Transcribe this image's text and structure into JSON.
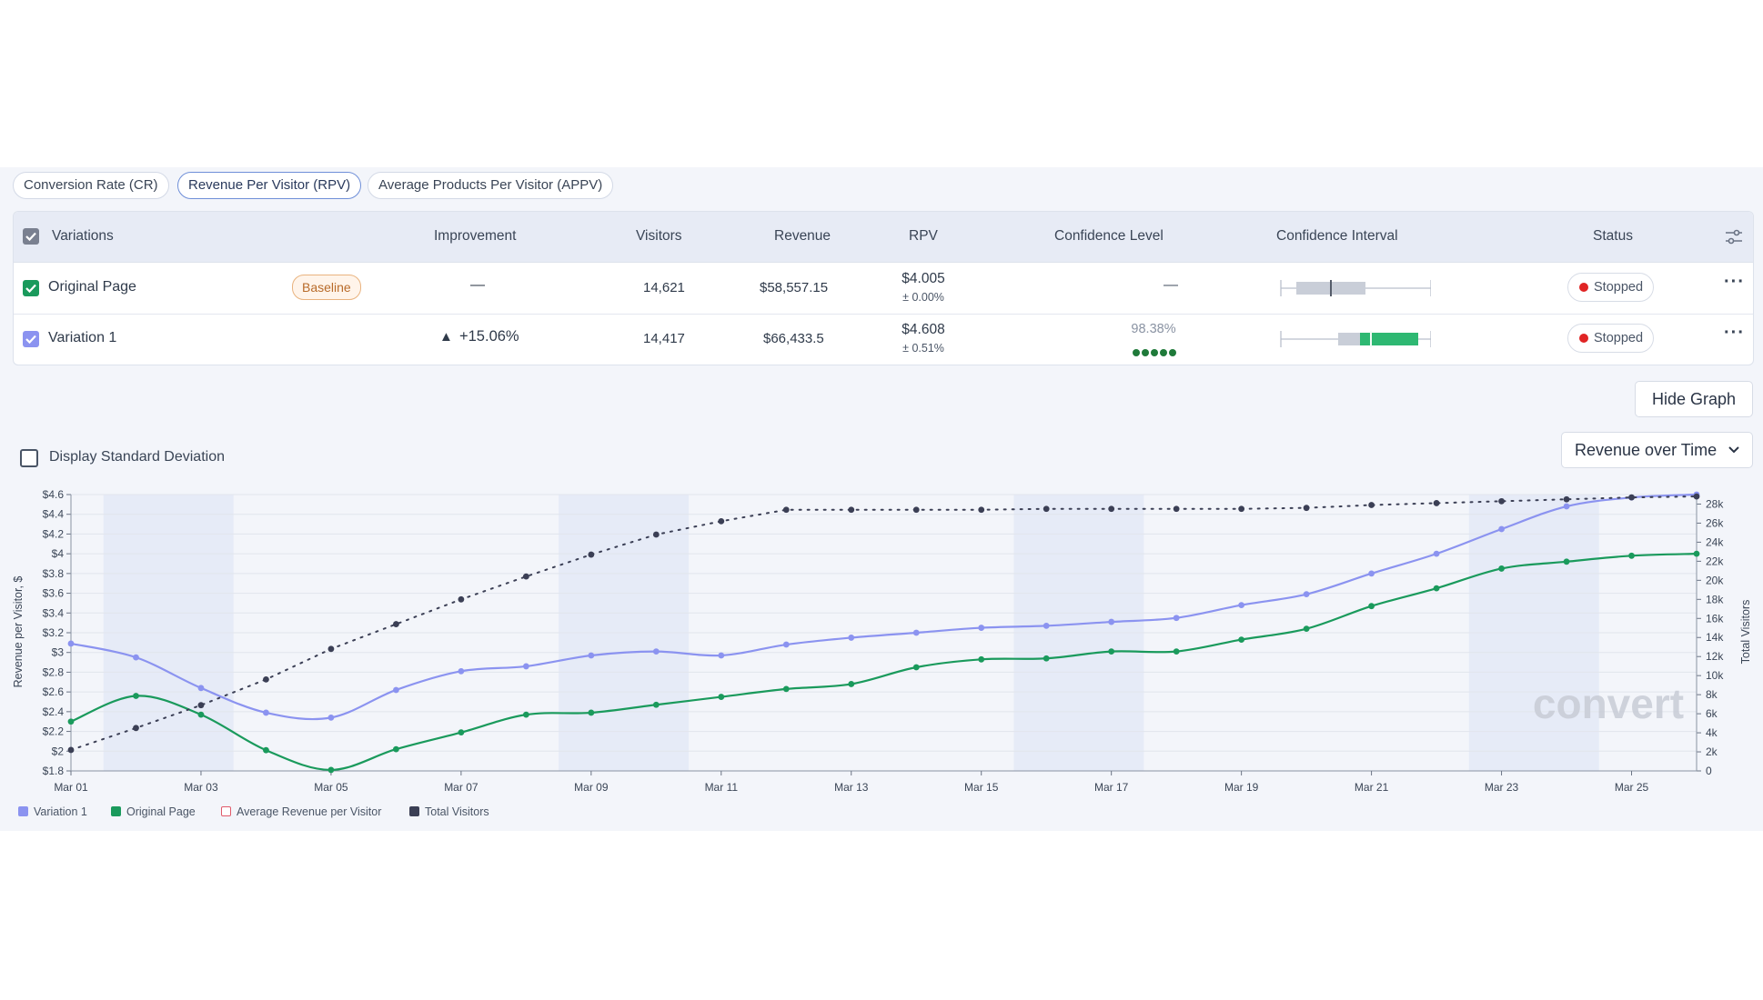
{
  "tabs": [
    {
      "label": "Conversion Rate (CR)",
      "active": false
    },
    {
      "label": "Revenue Per Visitor (RPV)",
      "active": true
    },
    {
      "label": "Average Products Per Visitor (APPV)",
      "active": false
    }
  ],
  "table": {
    "headers": {
      "variations": "Variations",
      "improvement": "Improvement",
      "visitors": "Visitors",
      "revenue": "Revenue",
      "rpv": "RPV",
      "confidence_level": "Confidence Level",
      "confidence_interval": "Confidence Interval",
      "status": "Status"
    },
    "rows": [
      {
        "name": "Original Page",
        "checkbox_color": "#1a9a5c",
        "badge": "Baseline",
        "improvement": "—",
        "visitors": "14,621",
        "revenue": "$58,557.15",
        "rpv": "$4.005",
        "rpv_error": "± 0.00%",
        "confidence": "—",
        "status": "Stopped"
      },
      {
        "name": "Variation 1",
        "checkbox_color": "#8b93f0",
        "improvement_arrow": "▲",
        "improvement": "+15.06%",
        "visitors": "14,417",
        "revenue": "$66,433.5",
        "rpv": "$4.608",
        "rpv_error": "± 0.51%",
        "confidence": "98.38%",
        "confidence_dots_filled": 5,
        "status": "Stopped"
      }
    ]
  },
  "hide_graph_label": "Hide Graph",
  "std_dev_label": "Display Standard Deviation",
  "dropdown_label": "Revenue over Time",
  "watermark": "convert",
  "colors": {
    "variation1": "#8b93f0",
    "original": "#1a9a5c",
    "visitors": "#3b3f55",
    "stopped": "#e02424",
    "highlight_band": "#e6ebf7",
    "avg_revenue_swatch": "#e05a6a"
  },
  "legend": [
    {
      "label": "Variation 1",
      "color": "#8b93f0",
      "style": "filled"
    },
    {
      "label": "Original Page",
      "color": "#1a9a5c",
      "style": "filled"
    },
    {
      "label": "Average Revenue per Visitor",
      "color": "#e05a6a",
      "style": "outline"
    },
    {
      "label": "Total Visitors",
      "color": "#3b3f55",
      "style": "filled"
    }
  ],
  "chart_data": {
    "type": "line",
    "ylabel": "Revenue per Visitor, $",
    "y2label": "Total Visitors",
    "x": [
      "Mar 01",
      "Mar 02",
      "Mar 03",
      "Mar 04",
      "Mar 05",
      "Mar 06",
      "Mar 07",
      "Mar 08",
      "Mar 09",
      "Mar 10",
      "Mar 11",
      "Mar 12",
      "Mar 13",
      "Mar 14",
      "Mar 15",
      "Mar 16",
      "Mar 17",
      "Mar 18",
      "Mar 19",
      "Mar 20",
      "Mar 21",
      "Mar 22",
      "Mar 23",
      "Mar 24",
      "Mar 25",
      "Mar 26"
    ],
    "x_tick_labels": [
      "Mar 01",
      "Mar 03",
      "Mar 05",
      "Mar 07",
      "Mar 09",
      "Mar 11",
      "Mar 13",
      "Mar 15",
      "Mar 17",
      "Mar 19",
      "Mar 21",
      "Mar 23",
      "Mar 25"
    ],
    "ylim": [
      1.8,
      4.6
    ],
    "y_ticks": [
      "$1.8",
      "$2",
      "$2.2",
      "$2.4",
      "$2.6",
      "$2.8",
      "$3",
      "$3.2",
      "$3.4",
      "$3.6",
      "$3.8",
      "$4",
      "$4.2",
      "$4.4",
      "$4.6"
    ],
    "y2lim": [
      0,
      29000
    ],
    "y2_ticks": [
      "0",
      "2k",
      "4k",
      "6k",
      "8k",
      "10k",
      "12k",
      "14k",
      "16k",
      "18k",
      "20k",
      "22k",
      "24k",
      "26k",
      "28k"
    ],
    "highlight_ranges": [
      [
        "Mar 01",
        "Mar 03"
      ],
      [
        "Mar 08",
        "Mar 10"
      ],
      [
        "Mar 15",
        "Mar 17"
      ],
      [
        "Mar 22",
        "Mar 24"
      ]
    ],
    "series": [
      {
        "name": "Variation 1",
        "axis": "left",
        "values": [
          3.09,
          2.95,
          2.64,
          2.39,
          2.34,
          2.62,
          2.81,
          2.86,
          2.97,
          3.01,
          2.97,
          3.08,
          3.15,
          3.2,
          3.25,
          3.27,
          3.31,
          3.35,
          3.48,
          3.59,
          3.8,
          4.0,
          4.25,
          4.48,
          4.57,
          4.6
        ]
      },
      {
        "name": "Original Page",
        "axis": "left",
        "values": [
          2.3,
          2.56,
          2.37,
          2.01,
          1.81,
          2.02,
          2.19,
          2.37,
          2.39,
          2.47,
          2.55,
          2.63,
          2.68,
          2.85,
          2.93,
          2.94,
          3.01,
          3.01,
          3.13,
          3.24,
          3.47,
          3.65,
          3.85,
          3.92,
          3.98,
          4.0
        ]
      },
      {
        "name": "Total Visitors",
        "axis": "right",
        "values": [
          2200,
          4500,
          6900,
          9600,
          12800,
          15400,
          18000,
          20400,
          22700,
          24800,
          26200,
          27400,
          27400,
          27400,
          27400,
          27500,
          27500,
          27500,
          27500,
          27600,
          27900,
          28100,
          28300,
          28500,
          28700,
          28800
        ]
      }
    ]
  }
}
